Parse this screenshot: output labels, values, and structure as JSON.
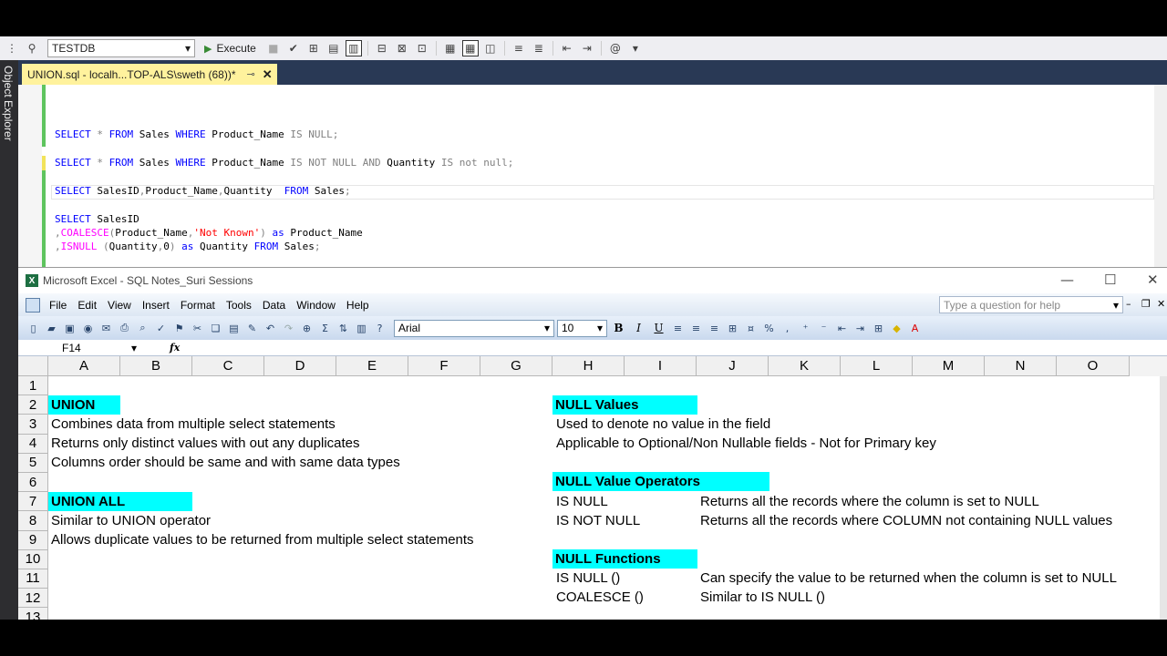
{
  "ssms": {
    "database": "TESTDB",
    "execute_label": "Execute",
    "object_explorer_label": "Object Explorer",
    "tab_title": "UNION.sql - localh...TOP-ALS\\sweth (68))*",
    "pin_glyph": "⊸",
    "close_glyph": "✕"
  },
  "code": {
    "l1": [
      "SELECT",
      " * ",
      "FROM",
      " Sales ",
      "WHERE",
      " Product_Name ",
      "IS NULL",
      ";"
    ],
    "l2": [
      "SELECT",
      " * ",
      "FROM",
      " Sales ",
      "WHERE",
      " Product_Name ",
      "IS NOT NULL AND",
      " Quantity ",
      "IS not null",
      ";"
    ],
    "l3": [
      "SELECT",
      " SalesID",
      ",",
      "Product_Name",
      ",",
      "Quantity  ",
      "FROM",
      " Sales",
      ";"
    ],
    "l4": [
      "SELECT",
      " SalesID"
    ],
    "l5": [
      ",",
      "COALESCE",
      "(",
      "Product_Name",
      ",",
      "'Not Known'",
      ")",
      " as ",
      "Product_Name"
    ],
    "l6": [
      ",",
      "ISNULL",
      " (",
      "Quantity",
      ",",
      "0",
      ")",
      " as ",
      "Quantity ",
      "FROM",
      " Sales",
      ";"
    ]
  },
  "excel": {
    "window_title": "Microsoft Excel - SQL Notes_Suri Sessions",
    "logo_letter": "X",
    "menu": [
      "File",
      "Edit",
      "View",
      "Insert",
      "Format",
      "Tools",
      "Data",
      "Window",
      "Help"
    ],
    "help_placeholder": "Type a question for help",
    "font": "Arial",
    "font_size": "10",
    "name_box": "F14",
    "fx": "fx",
    "columns": [
      "A",
      "B",
      "C",
      "D",
      "E",
      "F",
      "G",
      "H",
      "I",
      "J",
      "K",
      "L",
      "M",
      "N",
      "O"
    ],
    "rows": [
      "1",
      "2",
      "3",
      "4",
      "5",
      "6",
      "7",
      "8",
      "9",
      "10",
      "11",
      "12",
      "13"
    ],
    "cells": {
      "a2": "UNION",
      "a3": "Combines data from multiple select statements",
      "a4": "Returns only distinct values with out any duplicates",
      "a5": "Columns order should be same and with same data types",
      "a7": "UNION ALL",
      "a8": "Similar to UNION operator",
      "a9": "Allows duplicate values to be returned from multiple select statements",
      "h2": "NULL Values",
      "h3": "Used to denote no value in the field",
      "h4": "Applicable to Optional/Non Nullable fields - Not for Primary key",
      "h6": "NULL Value Operators",
      "h7": "IS NULL",
      "j7": "Returns all the records where the column is set to NULL",
      "h8": "IS NOT NULL",
      "j8": "Returns all the records where COLUMN not containing NULL values",
      "h10": "NULL Functions",
      "h11": "IS NULL ()",
      "j11": "Can specify the value to be returned when the column is set to NULL",
      "h12": "COALESCE ()",
      "j12": "Similar to IS NULL ()"
    }
  },
  "colors": {
    "highlight": "#00ffff",
    "keyword": "#0000ff",
    "function": "#ff00ff",
    "string": "#ff0000"
  }
}
